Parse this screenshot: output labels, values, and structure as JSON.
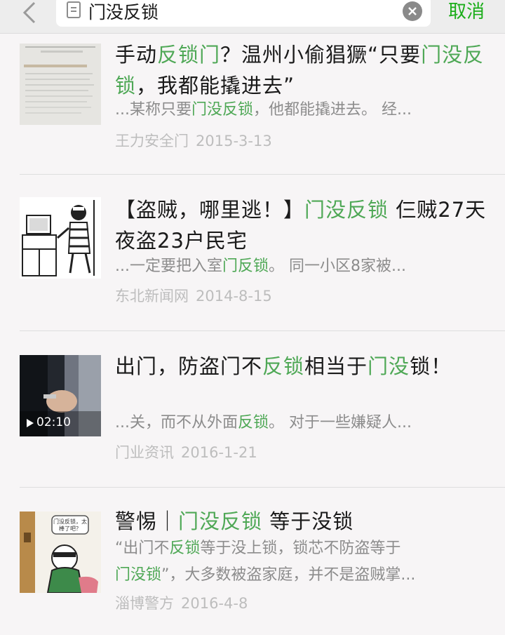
{
  "search": {
    "query": "门没反锁",
    "cancel_label": "取消"
  },
  "results": [
    {
      "title_segments": [
        {
          "text": "手动",
          "hl": false
        },
        {
          "text": "反锁门",
          "hl": true
        },
        {
          "text": "？温州小偷猖獗“只要",
          "hl": false
        },
        {
          "text": "门没反锁",
          "hl": true
        },
        {
          "text": "，我都能撬进去”",
          "hl": false
        }
      ],
      "snippet_segments": [
        {
          "text": "...某称只要",
          "hl": false
        },
        {
          "text": "门没反锁",
          "hl": true
        },
        {
          "text": "，他都能撬进去。 经...",
          "hl": false
        }
      ],
      "source": "王力安全门",
      "date": "2015-3-13"
    },
    {
      "title_segments": [
        {
          "text": "【盗贼，哪里逃！】",
          "hl": false
        },
        {
          "text": "门没反锁",
          "hl": true
        },
        {
          "text": " 仨贼27天夜盗23户民宅",
          "hl": false
        }
      ],
      "snippet_segments": [
        {
          "text": "...一定要把入室",
          "hl": false
        },
        {
          "text": "门反锁",
          "hl": true
        },
        {
          "text": "。 同一小区8家被...",
          "hl": false
        }
      ],
      "source": "东北新闻网",
      "date": "2014-8-15"
    },
    {
      "title_segments": [
        {
          "text": "出门，防盗门不",
          "hl": false
        },
        {
          "text": "反锁",
          "hl": true
        },
        {
          "text": "相当于",
          "hl": false
        },
        {
          "text": "门没",
          "hl": true
        },
        {
          "text": "锁！",
          "hl": false
        }
      ],
      "snippet_segments": [
        {
          "text": "...关，而不从外面",
          "hl": false
        },
        {
          "text": "反锁",
          "hl": true
        },
        {
          "text": "。 对于一些嫌疑人...",
          "hl": false
        }
      ],
      "source": "门业资讯",
      "date": "2016-1-21",
      "video_duration": "02:10"
    },
    {
      "title_segments": [
        {
          "text": "警惕｜",
          "hl": false
        },
        {
          "text": "门没反锁",
          "hl": true
        },
        {
          "text": " 等于没锁",
          "hl": false
        }
      ],
      "snippet_segments": [
        {
          "text": "“出门不",
          "hl": false
        },
        {
          "text": "反锁",
          "hl": true
        },
        {
          "text": "等于没上锁，锁芯不防盗等于",
          "hl": false
        }
      ],
      "snippet2_segments": [
        {
          "text": "门没锁",
          "hl": true
        },
        {
          "text": "”，大多数被盗家庭，并不是盗贼掌...",
          "hl": false
        }
      ],
      "source": "淄博警方",
      "date": "2016-4-8",
      "bubble_text": "门没反锁，太棒了吧？"
    }
  ]
}
